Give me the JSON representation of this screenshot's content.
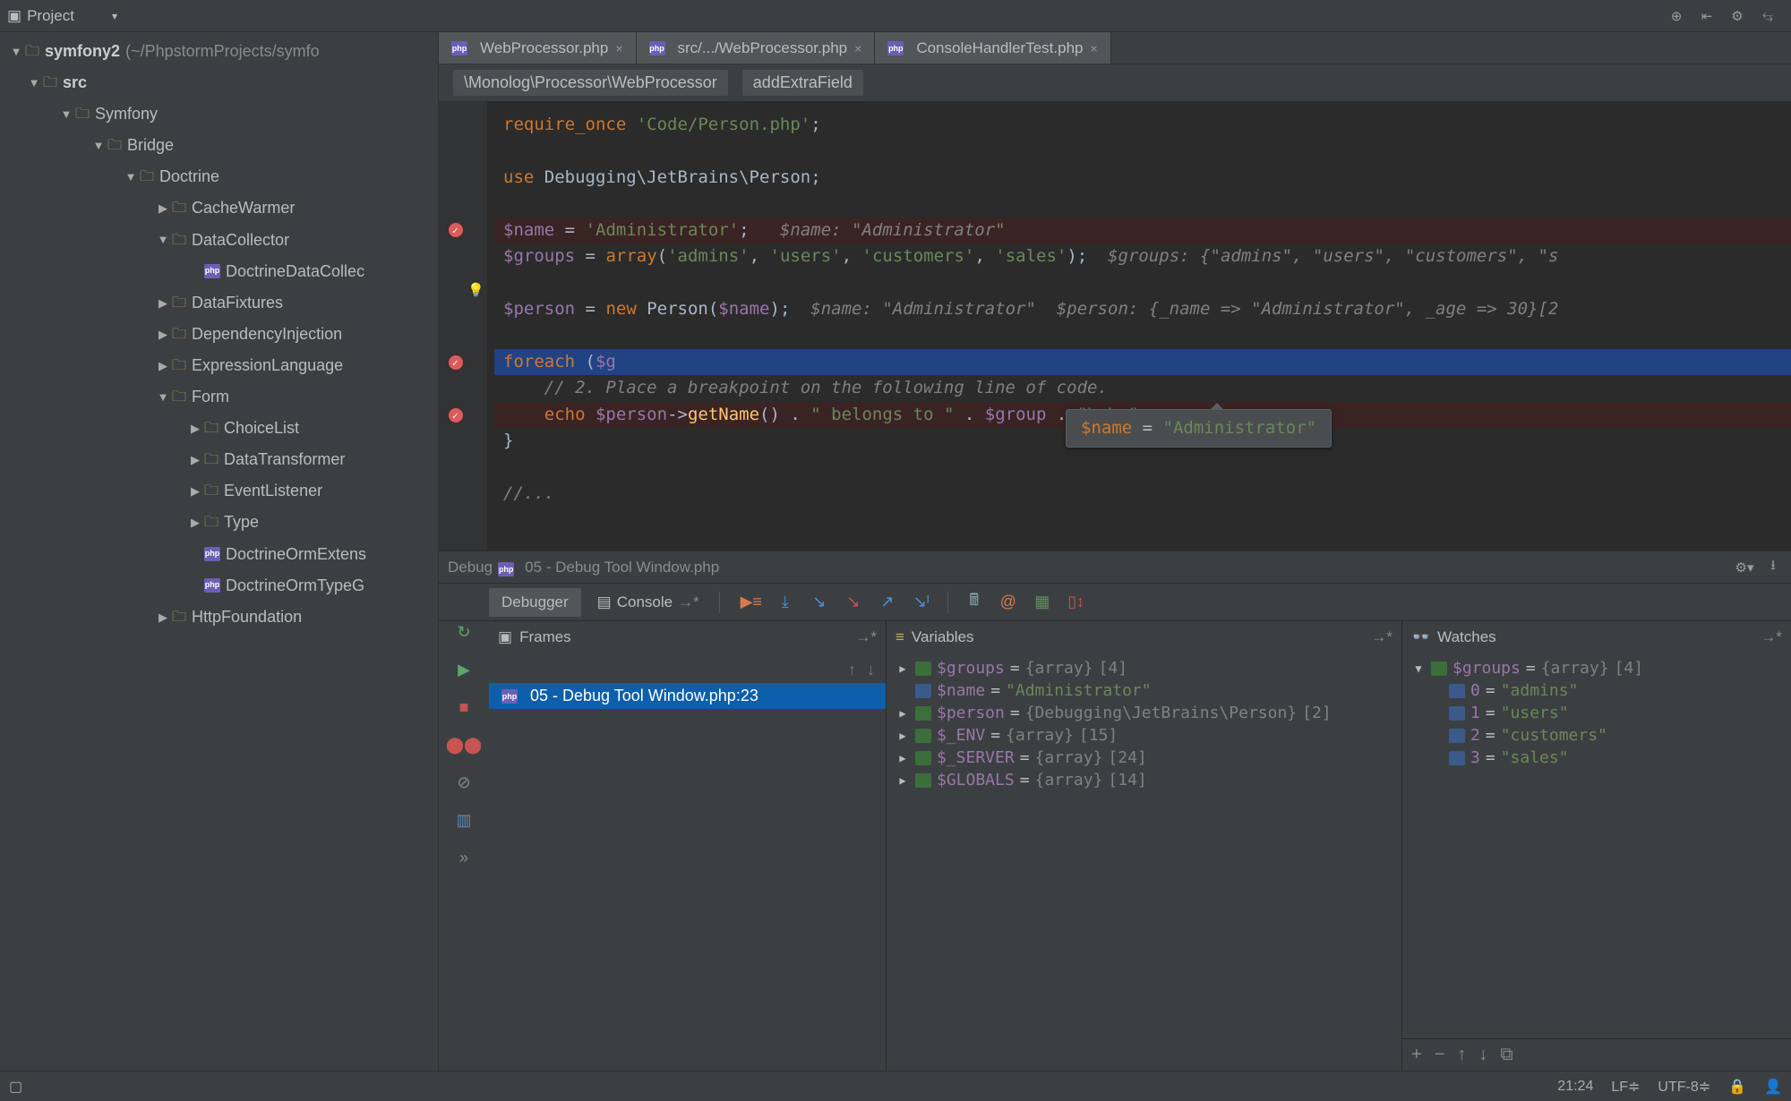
{
  "project": {
    "label": "Project",
    "root": "symfony2",
    "root_path": "(~/PhpstormProjects/symfo"
  },
  "toolbar_icons": [
    "target-icon",
    "collapse-icon",
    "gear-icon",
    "hide-icon"
  ],
  "tree": [
    {
      "depth": 0,
      "expand": "▼",
      "type": "folder",
      "label": "src",
      "bold": true
    },
    {
      "depth": 1,
      "expand": "▼",
      "type": "folder",
      "label": "Symfony"
    },
    {
      "depth": 2,
      "expand": "▼",
      "type": "folder",
      "label": "Bridge"
    },
    {
      "depth": 3,
      "expand": "▼",
      "type": "folder",
      "label": "Doctrine"
    },
    {
      "depth": 4,
      "expand": "▶",
      "type": "folder",
      "label": "CacheWarmer"
    },
    {
      "depth": 4,
      "expand": "▼",
      "type": "folder",
      "label": "DataCollector"
    },
    {
      "depth": 5,
      "expand": "",
      "type": "php",
      "label": "DoctrineDataCollec"
    },
    {
      "depth": 4,
      "expand": "▶",
      "type": "folder",
      "label": "DataFixtures"
    },
    {
      "depth": 4,
      "expand": "▶",
      "type": "folder",
      "label": "DependencyInjection"
    },
    {
      "depth": 4,
      "expand": "▶",
      "type": "folder",
      "label": "ExpressionLanguage"
    },
    {
      "depth": 4,
      "expand": "▼",
      "type": "folder",
      "label": "Form"
    },
    {
      "depth": 5,
      "expand": "▶",
      "type": "folder",
      "label": "ChoiceList"
    },
    {
      "depth": 5,
      "expand": "▶",
      "type": "folder",
      "label": "DataTransformer"
    },
    {
      "depth": 5,
      "expand": "▶",
      "type": "folder",
      "label": "EventListener"
    },
    {
      "depth": 5,
      "expand": "▶",
      "type": "folder",
      "label": "Type"
    },
    {
      "depth": 5,
      "expand": "",
      "type": "php",
      "label": "DoctrineOrmExtens"
    },
    {
      "depth": 5,
      "expand": "",
      "type": "php",
      "label": "DoctrineOrmTypeG"
    },
    {
      "depth": 4,
      "expand": "▶",
      "type": "folder",
      "label": "HttpFoundation"
    }
  ],
  "tabs": [
    {
      "icon": "php",
      "label": "WebProcessor.php"
    },
    {
      "icon": "php",
      "label": "src/.../WebProcessor.php"
    },
    {
      "icon": "php",
      "label": "ConsoleHandlerTest.php"
    }
  ],
  "breadcrumb": [
    "\\Monolog\\Processor\\WebProcessor",
    "addExtraField"
  ],
  "code": {
    "lines": [
      {
        "html": "<span class='k-orange'>require_once</span> <span class='k-green'>'Code/Person.php'</span><span class='k-white'>;</span>"
      },
      {
        "html": ""
      },
      {
        "html": "<span class='k-orange'>use</span> <span class='k-white'>Debugging\\JetBrains\\Person;</span>"
      },
      {
        "html": ""
      },
      {
        "bp": true,
        "html": "<span class='k-purple'>$name</span> <span class='k-white'>=</span> <span class='k-green'>'Administrator'</span><span class='k-white'>;</span>   <span class='k-grey'>$name: \"Administrator\"</span>"
      },
      {
        "html": "<span class='k-purple'>$groups</span> <span class='k-white'>=</span> <span class='k-orange'>array</span><span class='k-white'>(</span><span class='k-green'>'admins'</span><span class='k-white'>,</span> <span class='k-green'>'users'</span><span class='k-white'>,</span> <span class='k-green'>'customers'</span><span class='k-white'>,</span> <span class='k-green'>'sales'</span><span class='k-white'>);</span>  <span class='k-grey'>$groups: {\"admins\", \"users\", \"customers\", \"s</span>"
      },
      {
        "html": ""
      },
      {
        "html": "<span class='k-purple'>$person</span> <span class='k-white'>=</span> <span class='k-orange'>new</span> <span class='k-white'>Person(</span><span class='k-purple'>$name</span><span class='k-white'>);</span>  <span class='k-grey'>$name: \"Administrator\"  $person: {_name =&gt; \"Administrator\", _age =&gt; 30}[2</span>"
      },
      {
        "html": ""
      },
      {
        "exec": true,
        "bp": true,
        "html": "<span class='k-orange'>foreach</span> <span class='k-white'>(</span><span class='k-purple'>$g</span>"
      },
      {
        "html": "    <span class='k-grey'>// 2. Place a breakpoint on the following line of code.</span>"
      },
      {
        "bp": true,
        "html": "    <span class='k-orange'>echo</span> <span class='k-purple'>$person</span><span class='k-white'>-&gt;</span><span class='k-yellow'>getName</span><span class='k-white'>() .</span> <span class='k-green'>\" belongs to \"</span> <span class='k-white'>.</span> <span class='k-purple'>$group</span> <span class='k-white'>.</span> <span class='k-green'>\"\\r\\n\"</span><span class='k-white'>;</span>"
      },
      {
        "html": "<span class='k-white'>}</span>"
      },
      {
        "html": ""
      },
      {
        "html": "<span class='k-grey'>//...</span>"
      }
    ]
  },
  "tooltip": {
    "var": "$name",
    "eq": " = ",
    "val": "\"Administrator\""
  },
  "debug_bar": {
    "label": "Debug",
    "file": "05 - Debug Tool Window.php"
  },
  "debug_tabs": {
    "debugger": "Debugger",
    "console": "Console"
  },
  "frames": {
    "title": "Frames",
    "row": "05 - Debug Tool Window.php:23"
  },
  "variables": {
    "title": "Variables",
    "rows": [
      {
        "tw": "▶",
        "icon": "arr",
        "name": "$groups",
        "eq": " = ",
        "type": "{array} ",
        "extra": "[4]"
      },
      {
        "tw": "",
        "icon": "obj",
        "name": "$name",
        "eq": " = ",
        "str": "\"Administrator\""
      },
      {
        "tw": "▶",
        "icon": "arr",
        "name": "$person",
        "eq": " = ",
        "type": "{Debugging\\JetBrains\\Person} ",
        "extra": "[2]"
      },
      {
        "tw": "▶",
        "icon": "arr",
        "name": "$_ENV",
        "eq": " = ",
        "type": "{array} ",
        "extra": "[15]"
      },
      {
        "tw": "▶",
        "icon": "arr",
        "name": "$_SERVER",
        "eq": " = ",
        "type": "{array} ",
        "extra": "[24]"
      },
      {
        "tw": "▶",
        "icon": "arr",
        "name": "$GLOBALS",
        "eq": " = ",
        "type": "{array} ",
        "extra": "[14]"
      }
    ]
  },
  "watches": {
    "title": "Watches",
    "root": {
      "tw": "▼",
      "name": "$groups",
      "eq": " = ",
      "type": "{array} ",
      "extra": "[4]"
    },
    "items": [
      {
        "k": "0",
        "v": "\"admins\""
      },
      {
        "k": "1",
        "v": "\"users\""
      },
      {
        "k": "2",
        "v": "\"customers\""
      },
      {
        "k": "3",
        "v": "\"sales\""
      }
    ]
  },
  "status": {
    "pos": "21:24",
    "lf": "LF≑",
    "enc": "UTF-8≑"
  }
}
